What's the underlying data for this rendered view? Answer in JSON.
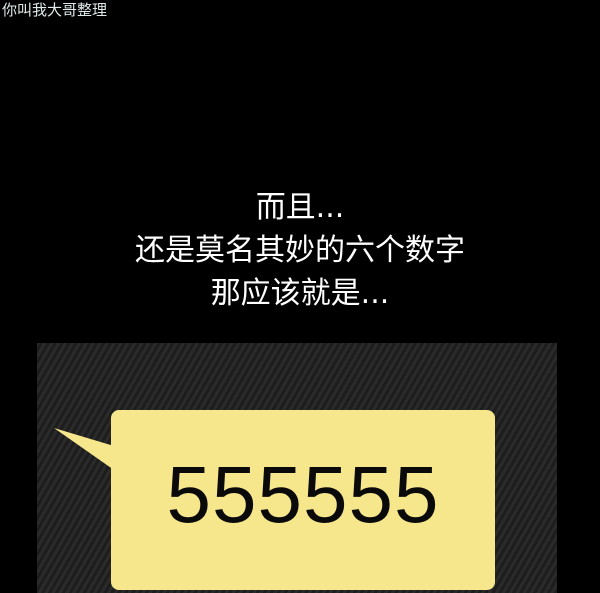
{
  "watermark": {
    "text": "你叫我大哥整理"
  },
  "caption": {
    "lines": [
      "而且...",
      "还是莫名其妙的六个数字",
      "那应该就是..."
    ]
  },
  "message_bubble": {
    "text": "555555",
    "bubble_color": "#f6e68c",
    "panel_color": "#232323"
  }
}
